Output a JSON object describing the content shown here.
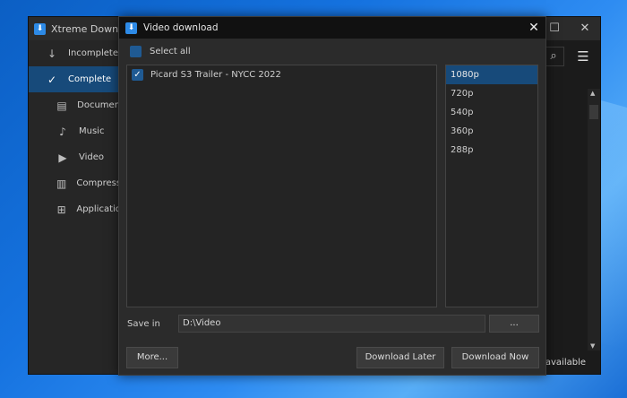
{
  "background_window": {
    "title": "Xtreme Download",
    "controls": {
      "maximize": "☐",
      "close": "✕"
    },
    "sidebar": [
      {
        "label": "Incomplete",
        "icon": "↓",
        "level": "top",
        "active": false
      },
      {
        "label": "Complete",
        "icon": "✓",
        "level": "top",
        "active": true
      },
      {
        "label": "Document",
        "icon": "▤",
        "level": "sub",
        "active": false
      },
      {
        "label": "Music",
        "icon": "♪",
        "level": "sub",
        "active": false
      },
      {
        "label": "Video",
        "icon": "▶",
        "level": "sub",
        "active": false
      },
      {
        "label": "Compresse",
        "icon": "▥",
        "level": "sub",
        "active": false
      },
      {
        "label": "Application",
        "icon": "⊞",
        "level": "sub",
        "active": false
      }
    ],
    "search_icon": "⌕",
    "menu_icon": "☰",
    "status_text": ") available"
  },
  "dialog": {
    "title": "Video download",
    "close_label": "✕",
    "select_all_label": "Select all",
    "videos": [
      {
        "title": "Picard S3 Trailer - NYCC 2022",
        "checked": true
      }
    ],
    "qualities": [
      {
        "label": "1080p",
        "selected": true
      },
      {
        "label": "720p",
        "selected": false
      },
      {
        "label": "540p",
        "selected": false
      },
      {
        "label": "360p",
        "selected": false
      },
      {
        "label": "288p",
        "selected": false
      }
    ],
    "save_in_label": "Save in",
    "save_in_value": "D:\\Video",
    "browse_label": "...",
    "more_label": "More...",
    "download_later_label": "Download Later",
    "download_now_label": "Download Now"
  },
  "colors": {
    "accent": "#1f5a93",
    "selection": "#174a7a",
    "window_bg": "#2b2b2b",
    "titlebar_bg": "#111111"
  }
}
